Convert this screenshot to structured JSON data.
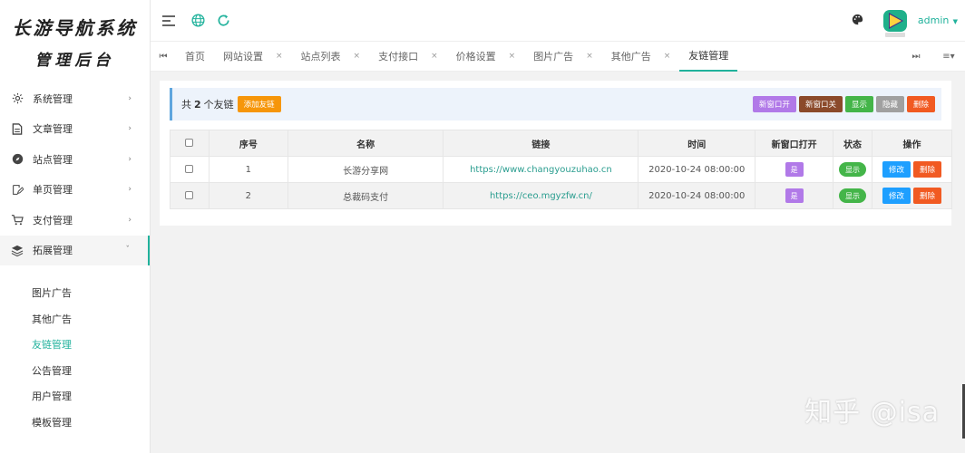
{
  "logo": {
    "line1": "长游导航系统",
    "line2": "管理后台"
  },
  "sidebar": {
    "items": [
      {
        "label": "系统管理",
        "icon": "gear-icon"
      },
      {
        "label": "文章管理",
        "icon": "document-icon"
      },
      {
        "label": "站点管理",
        "icon": "compass-icon"
      },
      {
        "label": "单页管理",
        "icon": "edit-icon"
      },
      {
        "label": "支付管理",
        "icon": "cart-icon"
      },
      {
        "label": "拓展管理",
        "icon": "layers-icon",
        "open": true
      }
    ],
    "submenu": [
      "图片广告",
      "其他广告",
      "友链管理",
      "公告管理",
      "用户管理",
      "模板管理"
    ],
    "active_submenu": "友链管理"
  },
  "header": {
    "user": "admin",
    "icons": [
      "menu-icon",
      "globe-icon",
      "refresh-icon",
      "palette-icon",
      "avatar"
    ]
  },
  "tabs": [
    {
      "label": "首页",
      "closable": false
    },
    {
      "label": "网站设置",
      "closable": true
    },
    {
      "label": "站点列表",
      "closable": true
    },
    {
      "label": "支付接口",
      "closable": true
    },
    {
      "label": "价格设置",
      "closable": true
    },
    {
      "label": "图片广告",
      "closable": true
    },
    {
      "label": "其他广告",
      "closable": true
    },
    {
      "label": "友链管理",
      "closable": false,
      "active": true
    }
  ],
  "toolbar": {
    "count_prefix": "共",
    "count": "2",
    "count_suffix": "个友链",
    "add_label": "添加友链",
    "open_new_label": "新窗口开",
    "close_new_label": "新窗口关",
    "show_label": "显示",
    "hide_label": "隐藏",
    "delete_label": "删除"
  },
  "table": {
    "headers": [
      "序号",
      "名称",
      "链接",
      "时间",
      "新窗口打开",
      "状态",
      "操作"
    ],
    "rows": [
      {
        "no": "1",
        "name": "长游分享网",
        "url": "https://www.changyouzuhao.cn",
        "time": "2020-10-24 08:00:00",
        "new_window": "是",
        "status": "显示",
        "edit": "修改",
        "delete": "删除"
      },
      {
        "no": "2",
        "name": "总裁码支付",
        "url": "https://ceo.mgyzfw.cn/",
        "time": "2020-10-24 08:00:00",
        "new_window": "是",
        "status": "显示",
        "edit": "修改",
        "delete": "删除"
      }
    ]
  },
  "watermark": "知乎 @isa",
  "colors": {
    "accent": "#21b29c",
    "add": "#f6960a",
    "purple": "#b179e8",
    "brown": "#8b4a2b",
    "green": "#44b549",
    "gray": "#a0a0a0",
    "red": "#f15a22",
    "blue": "#1e9fff"
  }
}
